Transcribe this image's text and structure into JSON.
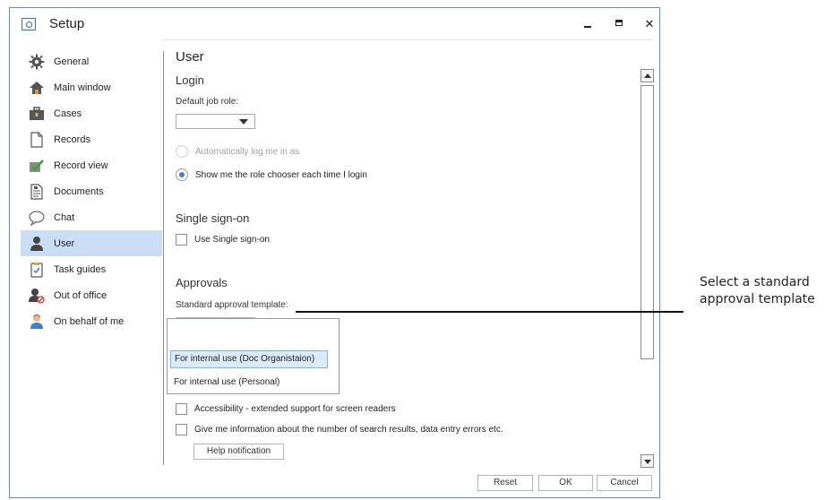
{
  "window": {
    "title": "Setup"
  },
  "sidebar": {
    "items": [
      {
        "label": "General",
        "icon": "gear-icon"
      },
      {
        "label": "Main window",
        "icon": "home-icon"
      },
      {
        "label": "Cases",
        "icon": "briefcase-icon"
      },
      {
        "label": "Records",
        "icon": "document-icon"
      },
      {
        "label": "Record view",
        "icon": "checkmark-icon"
      },
      {
        "label": "Documents",
        "icon": "text-document-icon"
      },
      {
        "label": "Chat",
        "icon": "speech-bubble-icon"
      },
      {
        "label": "User",
        "icon": "person-icon"
      },
      {
        "label": "Task guides",
        "icon": "clipboard-icon"
      },
      {
        "label": "Out of office",
        "icon": "person-blocked-icon"
      },
      {
        "label": "On behalf of me",
        "icon": "person-icon"
      }
    ],
    "active": "User"
  },
  "content": {
    "title": "User",
    "login": {
      "heading": "Login",
      "default_role_label": "Default job role:",
      "auto_login_label": "Automatically log me in as",
      "role_chooser_label": "Show me the role chooser each time I login"
    },
    "sso": {
      "heading": "Single sign-on",
      "use_sso_label": "Use Single sign-on"
    },
    "approvals": {
      "heading": "Approvals",
      "template_label": "Standard approval template:",
      "options": [
        "",
        "For internal use (Doc Organistaion)",
        "For internal use (Personal)"
      ],
      "highlighted": "For internal use (Doc Organistaion)"
    },
    "accessibility_label": "Accessibility - extended support for screen readers",
    "info_label": "Give me information about the number of search results, data entry errors etc.",
    "help_button": "Help notification"
  },
  "footer": {
    "reset": "Reset",
    "ok": "OK",
    "cancel": "Cancel"
  },
  "callout": {
    "line1": "Select a standard",
    "line2": "approval template"
  },
  "colors": {
    "accent": "#3f7fd0",
    "selection": "#c9def4",
    "window_border": "#5a8fd0"
  }
}
